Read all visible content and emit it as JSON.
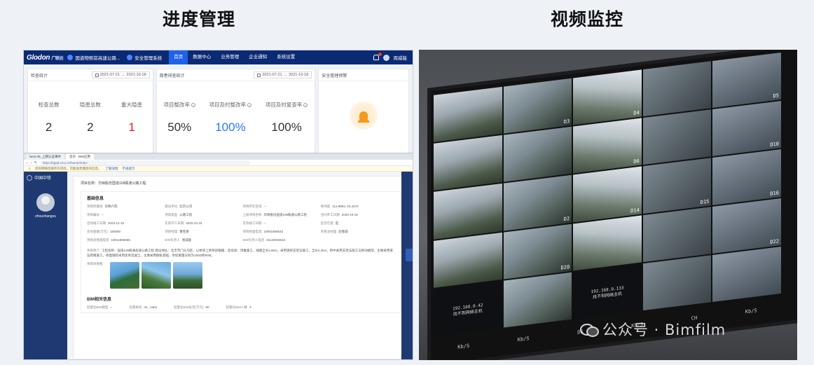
{
  "headings": {
    "left": "进度管理",
    "right": "视频监控"
  },
  "left_screen": {
    "topnav": {
      "logo": "Glodon",
      "logo_cn": "广联达",
      "project": "国道物侧前高速公路...",
      "system": "安全管理系统",
      "tabs": [
        "首页",
        "数据中心",
        "业务管理",
        "企业通知",
        "系统设置"
      ],
      "user": "周威能"
    },
    "cards": [
      {
        "title": "检查统计",
        "date_from": "2021-07-21",
        "date_to": "2021-10-18",
        "stats": [
          {
            "label": "检查总数",
            "value": "2"
          },
          {
            "label": "隐患总数",
            "value": "2"
          },
          {
            "label": "重大隐患",
            "value": "1"
          }
        ]
      },
      {
        "title": "隐患排查统计",
        "date_from": "2021-07-21",
        "date_to": "2021-10-18",
        "stats": [
          {
            "label": "项目整改率",
            "value": "50%"
          },
          {
            "label": "项目及时整改率",
            "value": "100%"
          },
          {
            "label": "项目及时复查率",
            "value": "100%"
          }
        ]
      },
      {
        "title": "安全管理预警"
      }
    ],
    "browser": {
      "tabs": [
        "Next 09_上网认证事件",
        "首页 - BIM应用"
      ],
      "url": "https://bgqd.cmo.cn/home/index",
      "warning": "您的网络连接存在风险，可能会泄漏您的信息。",
      "warning_link": "了解详情",
      "warning_link2": "不再提示",
      "brand": "中国中铁",
      "user": "zhouchangxu",
      "project_name_label": "项目名称：",
      "project_name": "华映股份国道108联通公路工程",
      "basic_info_title": "基础信息",
      "fields": [
        {
          "k": "项目所属地",
          "v": "华映六院"
        },
        {
          "k": "建设单位",
          "v": "北京公司"
        },
        {
          "k": "项目所在区域",
          "v": "--"
        },
        {
          "k": "经纬度",
          "v": "112.8983, 40.3370"
        },
        {
          "k": "项目编号",
          "v": "--"
        },
        {
          "k": "项目类型",
          "v": "公路工程"
        },
        {
          "k": "上级项目名称",
          "v": "华映股份国道108联通公路工程"
        },
        {
          "k": "合同开工日期",
          "v": "2020-10-19"
        },
        {
          "k": "合同竣工日期",
          "v": "2023-12-15"
        },
        {
          "k": "实际开工日期",
          "v": "2020-10-19"
        },
        {
          "k": "实际竣工日期",
          "v": "--"
        },
        {
          "k": "是否在建",
          "v": "是"
        },
        {
          "k": "合同金额(万元)",
          "v": "165000"
        },
        {
          "k": "项目经理",
          "v": "曹旺春"
        },
        {
          "k": "项目经理电话",
          "v": "15901966633"
        },
        {
          "k": "项目总经理",
          "v": "赵春森"
        },
        {
          "k": "项目总经理电话",
          "v": "15911966666"
        },
        {
          "k": "BIM负责人",
          "v": "周威能"
        },
        {
          "k": "BIM负责人电话",
          "v": "15120046615"
        },
        {
          "k": "",
          "v": ""
        }
      ],
      "desc_label": "项目简介",
      "desc": "工程名称：国道108联通高速公路工程 建设地址：北京市门头沟区，以桥梁上跨单斜钢箱、连续梁、顶推施工，线路全长4.6km。采用逐跨支架法施工，全长2.2km，跨中采用支架法施工与移动模架，主墩采用液压爬模施工，桥面铺装采用沥青混凝土，主墩采用群桩基础，单桩重量分别为1500t和900t。",
      "images_label": "项目效果图",
      "bim_title": "BIM相关信息",
      "bim_fields": [
        {
          "k": "轻量化BIM模型",
          "v": "--"
        },
        {
          "k": "轻量格式",
          "v": "rvt, .zaha"
        },
        {
          "k": "轻量化BIM投资(万元)",
          "v": "50"
        },
        {
          "k": "轻量化BIM人数",
          "v": "3"
        }
      ]
    }
  },
  "right_photo": {
    "camera_labels": [
      "",
      "D3",
      "D4",
      "",
      "D5",
      "",
      "",
      "D6",
      "",
      "D10",
      "",
      "D2",
      "D14",
      "D15",
      "D16",
      "",
      "D20",
      "",
      "",
      "D22",
      "",
      "",
      "",
      "",
      ""
    ],
    "offline_text": [
      "192.168.0.133",
      "找不到网络主机"
    ],
    "offline_text2": [
      "192.168.0.42",
      "找不到网络主机"
    ],
    "status_bar": [
      "Kb/S",
      "Kb/S",
      "DS",
      "Kb/S",
      "CH",
      "Kb/S"
    ]
  },
  "watermark": {
    "text": "公众号 · Bimfilm"
  }
}
